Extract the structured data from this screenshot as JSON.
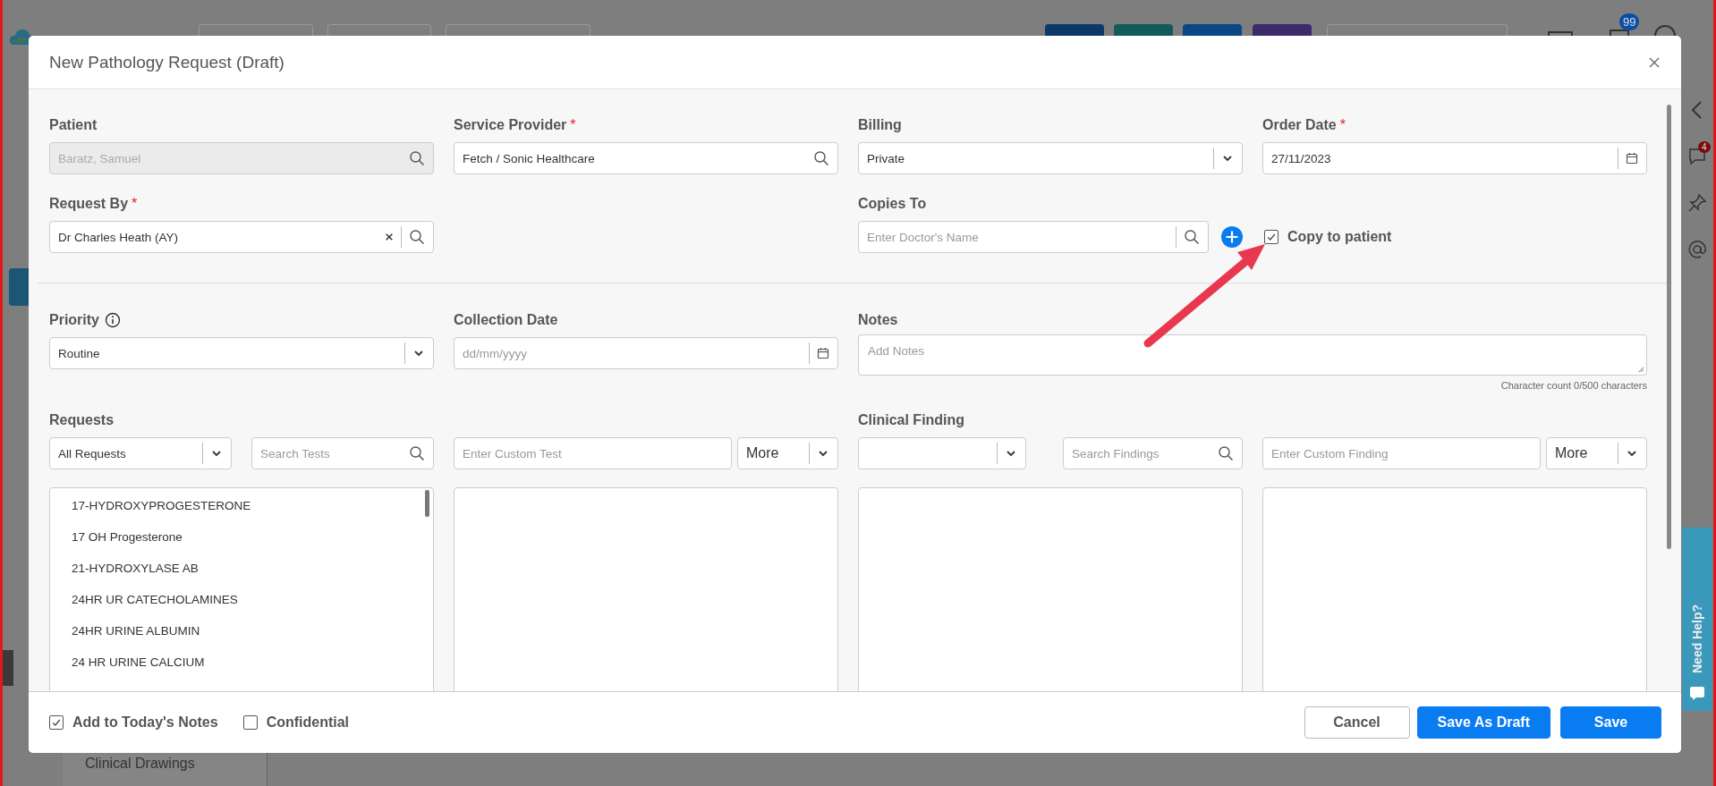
{
  "dialog": {
    "title": "New Pathology Request (Draft)"
  },
  "patient": {
    "label": "Patient",
    "value": "Baratz, Samuel",
    "disabled": true
  },
  "service_provider": {
    "label": "Service Provider",
    "required_mark": "*",
    "value": "Fetch / Sonic Healthcare"
  },
  "billing": {
    "label": "Billing",
    "value": "Private"
  },
  "order_date": {
    "label": "Order Date",
    "required_mark": "*",
    "value": "27/11/2023"
  },
  "request_by": {
    "label": "Request By",
    "required_mark": "*",
    "value": "Dr Charles Heath (AY)"
  },
  "copies_to": {
    "label": "Copies To",
    "placeholder": "Enter Doctor's Name",
    "copy_to_patient": {
      "label": "Copy to patient",
      "checked": true
    }
  },
  "priority": {
    "label": "Priority",
    "value": "Routine"
  },
  "collection_date": {
    "label": "Collection Date",
    "placeholder": "dd/mm/yyyy"
  },
  "notes": {
    "label": "Notes",
    "placeholder": "Add Notes",
    "character_count": "Character count 0/500 characters"
  },
  "requests": {
    "label": "Requests",
    "filter": "All Requests",
    "search_placeholder": "Search Tests",
    "custom_placeholder": "Enter Custom Test",
    "more": "More",
    "tests": [
      "17-HYDROXYPROGESTERONE",
      "17 OH Progesterone",
      "21-HYDROXYLASE AB",
      "24HR UR CATECHOLAMINES",
      "24HR URINE ALBUMIN",
      "24 HR URINE CALCIUM"
    ]
  },
  "clinical_finding": {
    "label": "Clinical Finding",
    "search_placeholder": "Search Findings",
    "custom_placeholder": "Enter Custom Finding",
    "more": "More"
  },
  "footer": {
    "options": [
      {
        "label": "Add to Today's Notes",
        "checked": true
      },
      {
        "label": "Confidential",
        "checked": false
      }
    ],
    "buttons": [
      {
        "label": "Cancel",
        "kind": "secondary"
      },
      {
        "label": "Save As Draft",
        "kind": "primary"
      },
      {
        "label": "Save",
        "kind": "primary"
      }
    ]
  },
  "background": {
    "notification_count": "99",
    "message_count": "4",
    "help_tab": "Need Help?",
    "sidebar_item": "Clinical Drawings"
  }
}
